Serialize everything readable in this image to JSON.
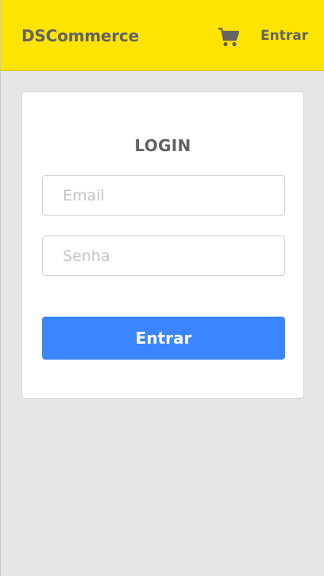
{
  "header": {
    "brand": "DSCommerce",
    "cart_icon": "shopping-cart-icon",
    "login_link": "Entrar"
  },
  "login_card": {
    "title": "LOGIN",
    "email_placeholder": "Email",
    "email_value": "",
    "password_placeholder": "Senha",
    "password_value": "",
    "submit_label": "Entrar"
  },
  "colors": {
    "header_bg": "#ffe400",
    "page_bg": "#e6e6e6",
    "primary_button": "#3a86ff",
    "text_dark": "#636363"
  }
}
